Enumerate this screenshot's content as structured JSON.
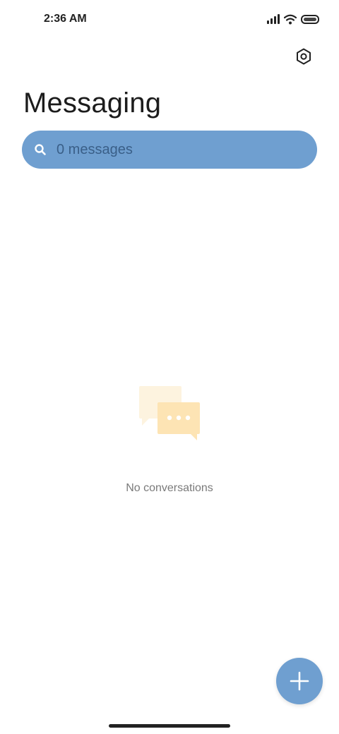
{
  "status_bar": {
    "time": "2:36 AM",
    "icons": [
      "signal-icon",
      "wifi-icon",
      "battery-icon"
    ]
  },
  "header": {
    "title": "Messaging",
    "settings_icon": "settings-icon"
  },
  "search": {
    "placeholder": "0 messages",
    "icon": "search-icon"
  },
  "empty_state": {
    "illustration": "chat-bubbles-icon",
    "label": "No conversations"
  },
  "fab": {
    "icon": "plus-icon"
  },
  "colors": {
    "accent": "#6f9fd0",
    "search_text": "#3a5f88",
    "bubble_light": "#fdf3df",
    "bubble_main": "#fde4b4"
  }
}
